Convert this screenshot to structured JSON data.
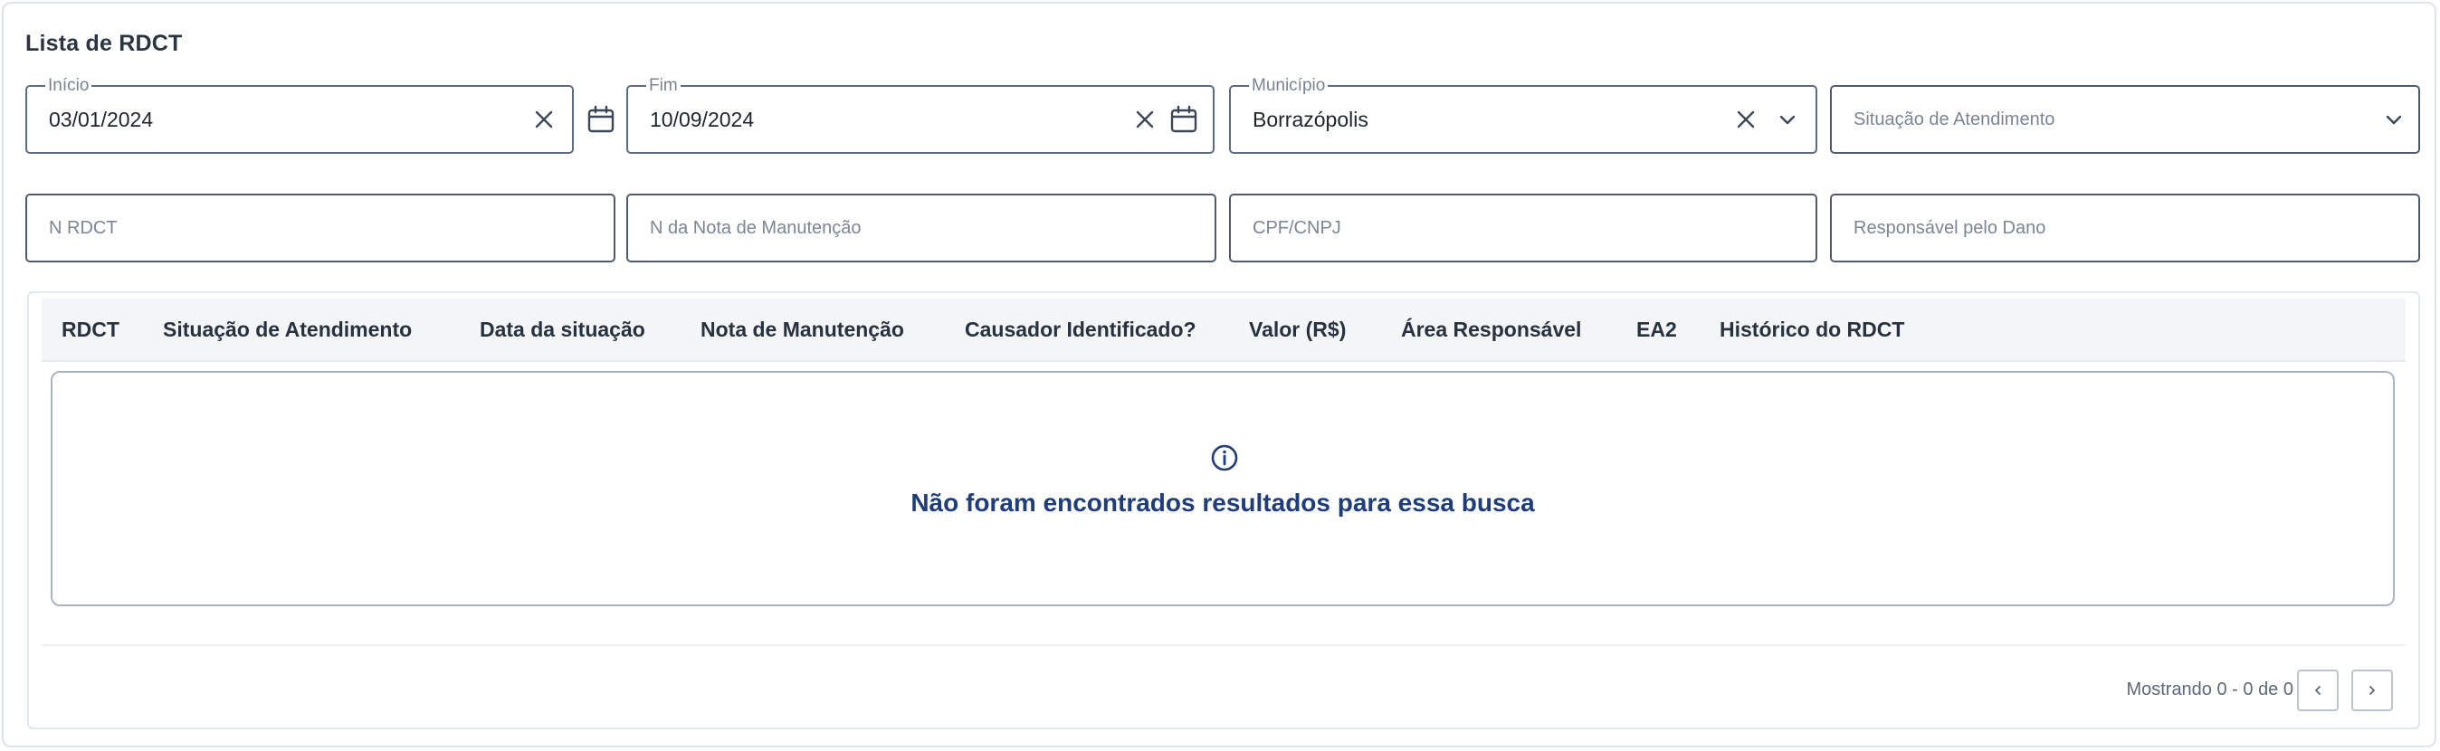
{
  "page": {
    "title": "Lista de RDCT"
  },
  "filters": {
    "inicio": {
      "label": "Início",
      "value": "03/01/2024"
    },
    "fim": {
      "label": "Fim",
      "value": "10/09/2024"
    },
    "municipio": {
      "label": "Município",
      "value": "Borrazópolis"
    },
    "situacao": {
      "placeholder": "Situação de Atendimento"
    },
    "n_rdct": {
      "placeholder": "N RDCT"
    },
    "n_nota": {
      "placeholder": "N da Nota de Manutenção"
    },
    "cpf_cnpj": {
      "placeholder": "CPF/CNPJ"
    },
    "responsavel": {
      "placeholder": "Responsável pelo Dano"
    }
  },
  "table": {
    "columns": [
      "RDCT",
      "Situação de Atendimento",
      "Data da situação",
      "Nota de Manutenção",
      "Causador Identificado?",
      "Valor (R$)",
      "Área Responsável",
      "EA2",
      "Histórico do RDCT"
    ],
    "empty_message": "Não foram encontrados resultados para essa busca"
  },
  "pagination": {
    "summary": "Mostrando 0 - 0 de 0"
  },
  "icons": {
    "clear": "close-icon",
    "calendar": "calendar-icon",
    "dropdown": "chevron-down-icon",
    "info": "info-icon",
    "prev": "chevron-left-icon",
    "next": "chevron-right-icon"
  },
  "colors": {
    "accent": "#1f3c7b",
    "border": "#5d6b84"
  }
}
